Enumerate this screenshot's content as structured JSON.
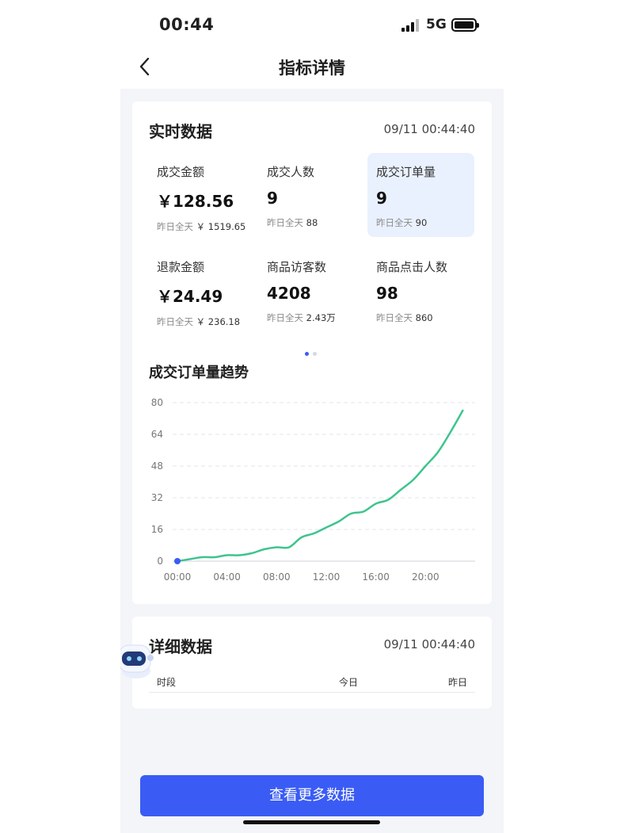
{
  "status_bar": {
    "time": "00:44",
    "network": "5G"
  },
  "nav": {
    "title": "指标详情"
  },
  "realtime": {
    "title": "实时数据",
    "timestamp": "09/11 00:44:40",
    "metrics": [
      {
        "label": "成交金额",
        "value": "￥128.56",
        "sub_label": "昨日全天",
        "sub_value": "￥ 1519.65",
        "active": false
      },
      {
        "label": "成交人数",
        "value": "9",
        "sub_label": "昨日全天",
        "sub_value": "88",
        "active": false
      },
      {
        "label": "成交订单量",
        "value": "9",
        "sub_label": "昨日全天",
        "sub_value": "90",
        "active": true
      },
      {
        "label": "退款金额",
        "value": "￥24.49",
        "sub_label": "昨日全天",
        "sub_value": "￥ 236.18",
        "active": false
      },
      {
        "label": "商品访客数",
        "value": "4208",
        "sub_label": "昨日全天",
        "sub_value": "2.43万",
        "active": false
      },
      {
        "label": "商品点击人数",
        "value": "98",
        "sub_label": "昨日全天",
        "sub_value": "860",
        "active": false
      }
    ],
    "pager": {
      "pages": 2,
      "current": 1
    }
  },
  "trend": {
    "title": "成交订单量趋势"
  },
  "chart_data": {
    "type": "line",
    "title": "成交订单量趋势",
    "xlabel": "",
    "ylabel": "",
    "x_ticks": [
      "00:00",
      "04:00",
      "08:00",
      "12:00",
      "16:00",
      "20:00"
    ],
    "y_ticks": [
      0,
      16,
      32,
      48,
      64,
      80
    ],
    "ylim": [
      0,
      80
    ],
    "xlim": [
      0,
      24
    ],
    "grid": true,
    "series": [
      {
        "color": "#3ec48e",
        "x": [
          0,
          1,
          2,
          3,
          4,
          5,
          6,
          7,
          8,
          9,
          10,
          11,
          12,
          13,
          14,
          15,
          16,
          17,
          18,
          19,
          20,
          21,
          22,
          23
        ],
        "values": [
          0,
          1,
          2,
          2,
          3,
          3,
          4,
          6,
          7,
          7,
          12,
          14,
          17,
          20,
          24,
          25,
          29,
          31,
          36,
          41,
          48,
          55,
          65,
          76
        ]
      }
    ]
  },
  "detail": {
    "title": "详细数据",
    "timestamp": "09/11 00:44:40",
    "columns": [
      "时段",
      "今日",
      "昨日"
    ]
  },
  "actions": {
    "more_label": "查看更多数据"
  },
  "colors": {
    "primary": "#3a5cf5",
    "line": "#3ec48e",
    "active_bg": "#eaf1fe",
    "page_bg": "#f3f5f8"
  }
}
